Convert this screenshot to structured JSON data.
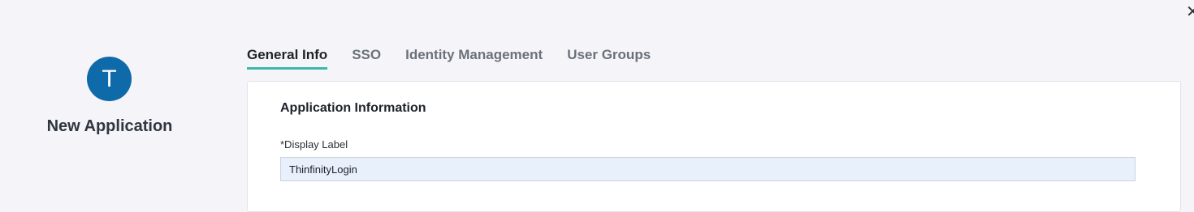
{
  "window": {
    "close_glyph": "✕"
  },
  "app": {
    "avatar_letter": "T",
    "name": "New Application",
    "avatar_color": "#0e6aa8"
  },
  "tabs": [
    {
      "label": "General Info",
      "active": true
    },
    {
      "label": "SSO",
      "active": false
    },
    {
      "label": "Identity Management",
      "active": false
    },
    {
      "label": "User Groups",
      "active": false
    }
  ],
  "section": {
    "title": "Application Information",
    "fields": [
      {
        "label": "*Display Label",
        "value": "ThinfinityLogin"
      }
    ]
  },
  "colors": {
    "accent": "#3bb8a8",
    "input_bg": "#e8f0fb",
    "page_bg": "#f5f5f9"
  }
}
